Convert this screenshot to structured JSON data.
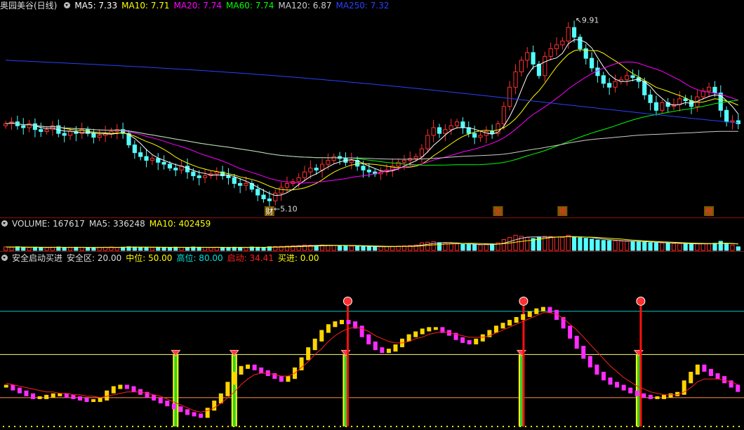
{
  "main": {
    "title": "奥园美谷(日线)",
    "indicators": [
      {
        "label": "MA5: 7.33",
        "color": "#ffffff"
      },
      {
        "label": "MA10: 7.71",
        "color": "#ffff00"
      },
      {
        "label": "MA20: 7.74",
        "color": "#ff00ff"
      },
      {
        "label": "MA60: 7.74",
        "color": "#00ff00"
      },
      {
        "label": "MA120: 6.87",
        "color": "#cccccc"
      },
      {
        "label": "MA250: 7.32",
        "color": "#2a40ff"
      }
    ],
    "high_label": "9.91",
    "low_label": "5.10",
    "markers": [
      "财",
      "张",
      "预",
      "榜"
    ]
  },
  "volume": {
    "indicators": [
      {
        "label": "VOLUME: 167617",
        "color": "#dddddd"
      },
      {
        "label": "MA5: 336248",
        "color": "#dddddd"
      },
      {
        "label": "MA10: 402459",
        "color": "#ffff00"
      }
    ]
  },
  "signal": {
    "indicators": [
      {
        "label": "安全启动买进",
        "color": "#dddddd"
      },
      {
        "label": "安全区: 20.00",
        "color": "#dddddd"
      },
      {
        "label": "中位: 50.00",
        "color": "#ffff00"
      },
      {
        "label": "高位: 80.00",
        "color": "#00e0e0"
      },
      {
        "label": "启动: 34.41",
        "color": "#ff2020"
      },
      {
        "label": "买进: 0.00",
        "color": "#ffff00"
      }
    ]
  },
  "colors": {
    "up": "#ff3030",
    "down": "#54ffff",
    "rising": "#ffd400",
    "falling": "#ff2cff"
  },
  "chart_data": {
    "type": "candlestick",
    "price_range": [
      5.0,
      10.1
    ],
    "closes": [
      7.25,
      7.3,
      7.2,
      7.15,
      7.25,
      7.1,
      7.05,
      7.1,
      7.2,
      7.0,
      6.95,
      7.05,
      7.0,
      7.1,
      7.0,
      6.9,
      6.95,
      7.0,
      7.05,
      7.1,
      7.0,
      6.7,
      6.5,
      6.4,
      6.3,
      6.35,
      6.25,
      6.2,
      6.1,
      6.05,
      6.15,
      6.0,
      5.9,
      5.85,
      5.9,
      5.95,
      6.0,
      5.9,
      5.85,
      5.7,
      5.65,
      5.7,
      5.55,
      5.4,
      5.3,
      5.25,
      5.45,
      5.6,
      5.7,
      5.75,
      5.85,
      6.0,
      6.1,
      6.05,
      6.2,
      6.3,
      6.4,
      6.35,
      6.25,
      6.3,
      6.15,
      6.05,
      6.0,
      5.95,
      6.0,
      6.05,
      6.15,
      6.25,
      6.3,
      6.35,
      6.4,
      6.6,
      6.95,
      7.15,
      7.0,
      7.1,
      7.2,
      7.3,
      7.15,
      7.0,
      6.9,
      6.95,
      7.05,
      7.0,
      7.25,
      7.7,
      8.2,
      8.6,
      8.9,
      9.1,
      8.8,
      8.5,
      9.0,
      9.2,
      9.3,
      9.4,
      9.75,
      9.5,
      9.2,
      8.95,
      8.7,
      8.5,
      8.3,
      8.2,
      8.35,
      8.4,
      8.5,
      8.45,
      8.35,
      8.0,
      7.8,
      7.6,
      7.8,
      7.7,
      7.75,
      7.9,
      7.85,
      7.7,
      7.95,
      8.1,
      8.2,
      8.05,
      7.6,
      7.3,
      7.33,
      7.25
    ],
    "volume_max": 1000000,
    "volumes": [
      160000,
      150000,
      170000,
      140000,
      130000,
      150000,
      140000,
      130000,
      150000,
      160000,
      140000,
      130000,
      150000,
      140000,
      130000,
      120000,
      140000,
      150000,
      160000,
      140000,
      150000,
      170000,
      160000,
      150000,
      140000,
      130000,
      150000,
      140000,
      130000,
      150000,
      140000,
      130000,
      160000,
      150000,
      140000,
      130000,
      150000,
      140000,
      130000,
      150000,
      140000,
      130000,
      160000,
      150000,
      140000,
      170000,
      180000,
      190000,
      200000,
      210000,
      220000,
      250000,
      240000,
      230000,
      250000,
      240000,
      230000,
      220000,
      210000,
      200000,
      190000,
      180000,
      170000,
      160000,
      170000,
      180000,
      190000,
      200000,
      210000,
      220000,
      250000,
      350000,
      380000,
      400000,
      360000,
      340000,
      320000,
      300000,
      280000,
      270000,
      260000,
      250000,
      280000,
      300000,
      350000,
      500000,
      600000,
      700000,
      650000,
      600000,
      550000,
      620000,
      650000,
      640000,
      620000,
      600000,
      700000,
      620000,
      580000,
      560000,
      520000,
      480000,
      460000,
      450000,
      440000,
      430000,
      420000,
      410000,
      400000,
      380000,
      360000,
      350000,
      340000,
      330000,
      320000,
      310000,
      300000,
      290000,
      300000,
      310000,
      320000,
      330000,
      420000,
      300000,
      250000,
      167617
    ],
    "signal_range": [
      0,
      112
    ],
    "signal_levels": {
      "safe": 20,
      "mid": 50,
      "high": 80
    },
    "signal_values": [
      28,
      26,
      24,
      22,
      20,
      20,
      21,
      22,
      22,
      21,
      20,
      19,
      18,
      18,
      19,
      24,
      27,
      28,
      27,
      25,
      23,
      21,
      19,
      17,
      15,
      13,
      11,
      9,
      8,
      7,
      12,
      17,
      22,
      30,
      37,
      41,
      42,
      40,
      38,
      36,
      34,
      32,
      34,
      40,
      47,
      54,
      60,
      66,
      70,
      72,
      73,
      72,
      69,
      63,
      58,
      54,
      52,
      53,
      56,
      60,
      63,
      65,
      67,
      68,
      68,
      66,
      64,
      61,
      59,
      58,
      60,
      63,
      66,
      69,
      71,
      73,
      75,
      77,
      79,
      81,
      82,
      80,
      75,
      69,
      62,
      55,
      48,
      42,
      37,
      33,
      30,
      28,
      26,
      24,
      22,
      21,
      20,
      20,
      21,
      22,
      23,
      31,
      37,
      42,
      39,
      36,
      34,
      31,
      28,
      25
    ],
    "signal_line": [
      30,
      29,
      28,
      27,
      26,
      25,
      24,
      24,
      23,
      23,
      22,
      22,
      21,
      21,
      20,
      21,
      22,
      23,
      24,
      24,
      24,
      23,
      22,
      21,
      19,
      17,
      15,
      13,
      11,
      10,
      11,
      13,
      16,
      20,
      24,
      29,
      33,
      36,
      37,
      37,
      36,
      35,
      35,
      37,
      41,
      45,
      50,
      54,
      59,
      63,
      66,
      68,
      69,
      68,
      66,
      63,
      61,
      59,
      58,
      58,
      59,
      61,
      62,
      64,
      65,
      66,
      65,
      64,
      63,
      62,
      62,
      62,
      63,
      65,
      67,
      69,
      71,
      73,
      75,
      77,
      79,
      79,
      78,
      75,
      71,
      67,
      62,
      57,
      52,
      47,
      42,
      38,
      34,
      31,
      28,
      26,
      24,
      23,
      22,
      22,
      22,
      24,
      27,
      31,
      33,
      33,
      33,
      32,
      31,
      29
    ],
    "buy_signal_indices": [
      29,
      39,
      58,
      88,
      108
    ],
    "start_signal_indices": [
      58,
      88,
      108
    ]
  }
}
